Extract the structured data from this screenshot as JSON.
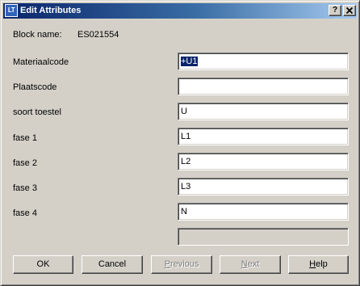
{
  "window": {
    "title": "Edit Attributes",
    "app_icon_text": "LT",
    "help_button": "?",
    "close_button": "X"
  },
  "block": {
    "label": "Block name:",
    "value": "ES021554"
  },
  "attributes": [
    {
      "label": "Materiaalcode",
      "value": "+U1",
      "selected": true
    },
    {
      "label": "Plaatscode",
      "value": ""
    },
    {
      "label": "soort toestel",
      "value": "U"
    },
    {
      "label": "fase 1",
      "value": "L1"
    },
    {
      "label": "fase 2",
      "value": "L2"
    },
    {
      "label": "fase 3",
      "value": "L3"
    },
    {
      "label": "fase 4",
      "value": "N"
    }
  ],
  "extra_field": {
    "value": "",
    "enabled": false
  },
  "buttons": {
    "ok": "OK",
    "cancel": "Cancel",
    "previous_first": "P",
    "previous_rest": "revious",
    "next_first": "N",
    "next_rest": "ext",
    "help_first": "H",
    "help_rest": "elp"
  }
}
